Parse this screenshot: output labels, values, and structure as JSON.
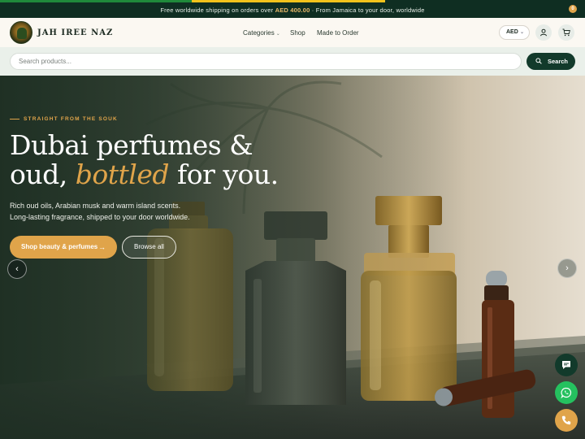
{
  "announcement": {
    "before": "Free worldwide shipping on orders over",
    "amount": "AED 400.00",
    "after": "· From Jamaica to your door, worldwide"
  },
  "header": {
    "brand": "JAH IREE NAZ",
    "nav": {
      "categories": "Categories",
      "shop": "Shop",
      "made_to_order": "Made to Order"
    },
    "currency": "AED",
    "cart_count": "0"
  },
  "search": {
    "placeholder": "Search products...",
    "button_label": "Search"
  },
  "hero": {
    "eyebrow": "STRAIGHT FROM THE SOUK",
    "headline_line1": "Dubai perfumes &",
    "headline_oud": "oud,",
    "headline_accent": "bottled",
    "headline_end": "for you.",
    "subtext_line1": "Rich oud oils, Arabian musk and warm island scents.",
    "subtext_line2": "Long-lasting fragrance, shipped to your door worldwide.",
    "primary_cta": "Shop beauty & perfumes",
    "secondary_cta": "Browse all"
  },
  "colors": {
    "brand_dark": "#123a2b",
    "accent_gold": "#e0a44a",
    "whatsapp_green": "#25c15f"
  },
  "icons": {
    "user": "user-icon",
    "cart": "cart-icon",
    "search": "search-icon",
    "chat": "chat-icon",
    "whatsapp": "whatsapp-icon",
    "phone": "phone-icon"
  }
}
